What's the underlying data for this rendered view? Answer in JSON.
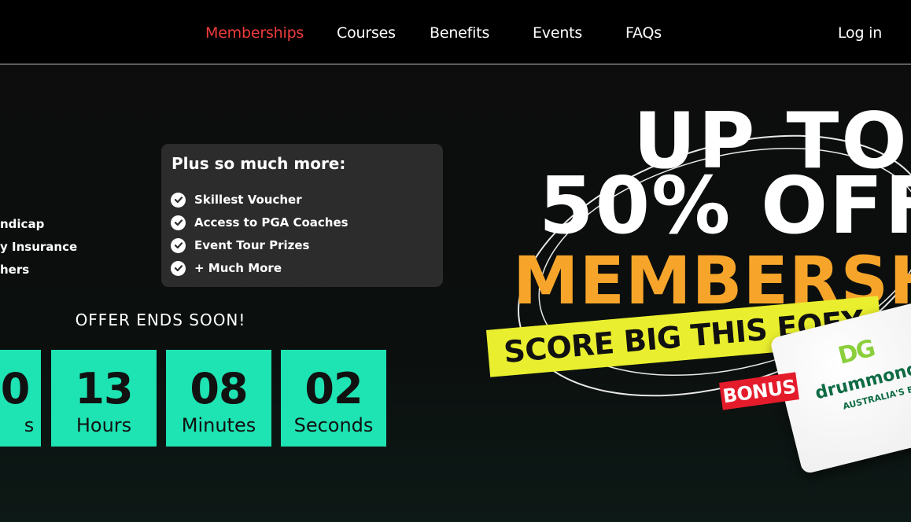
{
  "nav": {
    "items": [
      "Memberships",
      "Courses",
      "Benefits",
      "Events",
      "FAQs"
    ],
    "active": "Memberships",
    "login": "Log in"
  },
  "perks_left": [
    "ndicap",
    "y Insurance",
    "hers"
  ],
  "more_card": {
    "title": "Plus so much more:",
    "items": [
      "Skillest Voucher",
      "Access to PGA Coaches",
      "Event Tour Prizes",
      "+ Much More"
    ]
  },
  "offer": {
    "title": "OFFER ENDS SOON!",
    "countdown": [
      {
        "value": "0",
        "unit": "s"
      },
      {
        "value": "13",
        "unit": "Hours"
      },
      {
        "value": "08",
        "unit": "Minutes"
      },
      {
        "value": "02",
        "unit": "Seconds"
      }
    ]
  },
  "promo": {
    "line1": "UP TO",
    "line2": "50% OFF",
    "line3": "MEMBERSHIP",
    "banner": "SCORE BIG THIS EOFY",
    "bonus": "BONUS",
    "card_logo": "DG",
    "card_name": "drummond g",
    "card_tagline": "AUSTRALIA'S BIGGES"
  },
  "colors": {
    "accent_red": "#ef3b3b",
    "countdown_teal": "#1ee3b2",
    "membership_orange": "#f7a52a",
    "banner_yellow": "#e9ef2e",
    "bonus_red": "#e41b2b",
    "card_panel": "#2c2c2c"
  },
  "icons": [
    "check-icon"
  ]
}
